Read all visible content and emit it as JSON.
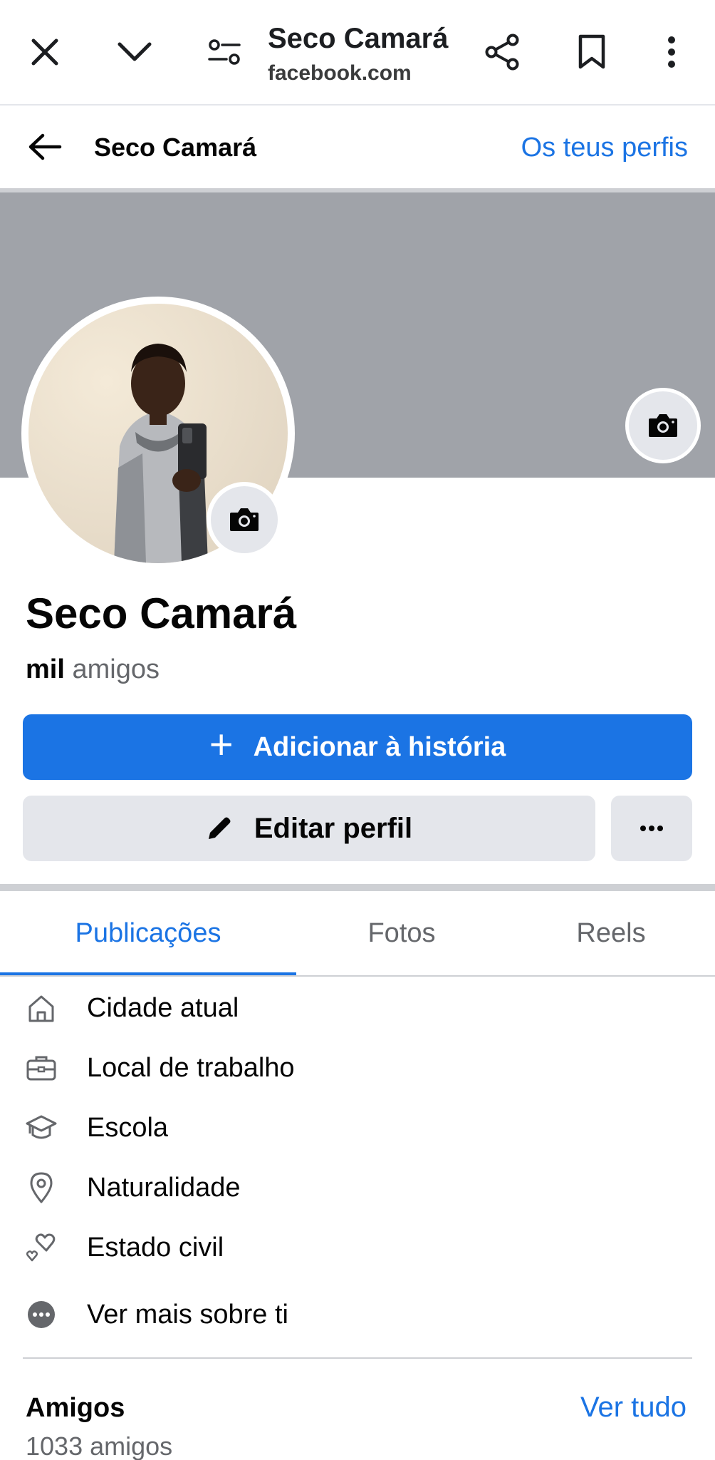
{
  "browser": {
    "title": "Seco Camará",
    "url": "facebook.com",
    "icons": [
      "close-icon",
      "chevron-down-icon",
      "tune-icon",
      "share-icon",
      "bookmark-icon",
      "more-vert-icon"
    ]
  },
  "header": {
    "title": "Seco Camará",
    "link": "Os teus perfis"
  },
  "profile": {
    "name": "Seco Camará",
    "friends_bold": "mil",
    "friends_suffix": " amigos"
  },
  "actions": {
    "add_story": "Adicionar à história",
    "edit_profile": "Editar perfil"
  },
  "tabs": [
    {
      "label": "Publicações",
      "active": true
    },
    {
      "label": "Fotos",
      "active": false
    },
    {
      "label": "Reels",
      "active": false
    }
  ],
  "details": [
    {
      "label": "Cidade atual",
      "icon": "home-icon"
    },
    {
      "label": "Local de trabalho",
      "icon": "briefcase-icon"
    },
    {
      "label": "Escola",
      "icon": "graduation-cap-icon"
    },
    {
      "label": "Naturalidade",
      "icon": "location-pin-icon"
    },
    {
      "label": "Estado civil",
      "icon": "hearts-icon"
    },
    {
      "label": "Ver mais sobre ti",
      "icon": "more-dots-icon"
    }
  ],
  "friends": {
    "title": "Amigos",
    "link": "Ver tudo",
    "count": "1033 amigos"
  },
  "colors": {
    "accent": "#1b74e4",
    "cover": "#a0a3a9",
    "button_secondary": "#e4e6eb"
  }
}
